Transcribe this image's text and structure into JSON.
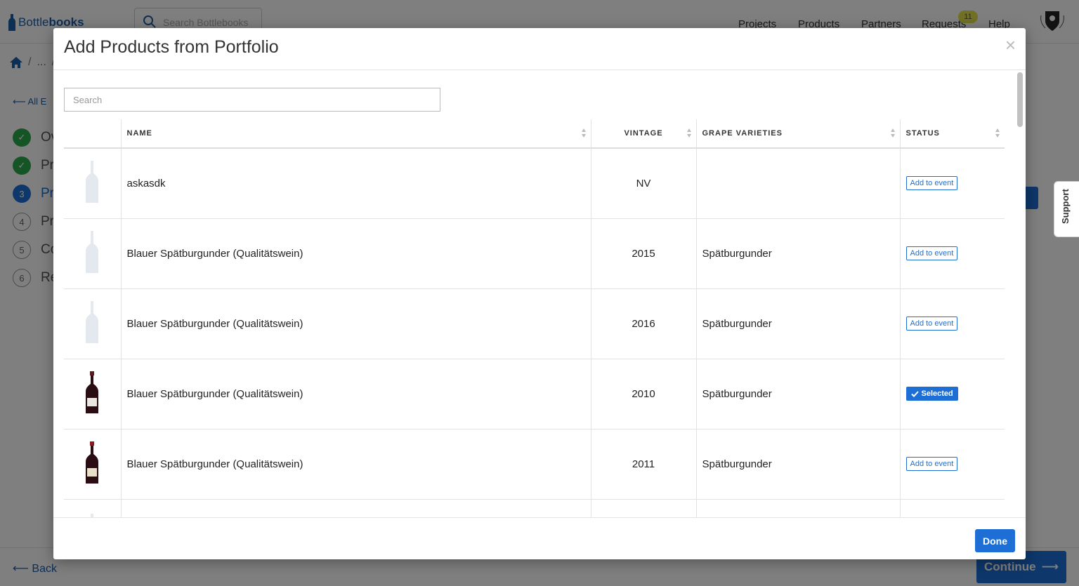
{
  "app": {
    "logo_prefix": "Bottle",
    "logo_suffix": "books",
    "search_placeholder": "Search Bottlebooks",
    "nav": [
      "Projects",
      "Products",
      "Partners",
      "Requests",
      "Help"
    ],
    "requests_badge": "11"
  },
  "breadcrumb": {
    "ellipsis": "..."
  },
  "sidebar": {
    "back_label": "All E",
    "steps": [
      {
        "marker": "✓",
        "label": "Ov",
        "state": "done"
      },
      {
        "marker": "✓",
        "label": "Pr",
        "state": "done"
      },
      {
        "marker": "3",
        "label": "Pr",
        "state": "current"
      },
      {
        "marker": "4",
        "label": "Pr",
        "state": "todo"
      },
      {
        "marker": "5",
        "label": "Co",
        "state": "todo"
      },
      {
        "marker": "6",
        "label": "Re",
        "state": "todo"
      }
    ]
  },
  "support_label": "Support",
  "footer": {
    "back_label": "Back",
    "continue_label": "Continue"
  },
  "modal": {
    "title": "Add Products from Portfolio",
    "close": "×",
    "search_placeholder": "Search",
    "columns": {
      "name": "NAME",
      "vintage": "VINTAGE",
      "grape": "GRAPE VARIETIES",
      "status": "STATUS"
    },
    "rows": [
      {
        "name": "askasdk",
        "vintage": "NV",
        "grape": "",
        "status": "Add to event",
        "selected": false,
        "image": "placeholder"
      },
      {
        "name": "Blauer Spätburgunder (Qualitätswein)",
        "vintage": "2015",
        "grape": "Spätburgunder",
        "status": "Add to event",
        "selected": false,
        "image": "placeholder"
      },
      {
        "name": "Blauer Spätburgunder (Qualitätswein)",
        "vintage": "2016",
        "grape": "Spätburgunder",
        "status": "Add to event",
        "selected": false,
        "image": "placeholder"
      },
      {
        "name": "Blauer Spätburgunder (Qualitätswein)",
        "vintage": "2010",
        "grape": "Spätburgunder",
        "status": "Selected",
        "selected": true,
        "image": "bottle"
      },
      {
        "name": "Blauer Spätburgunder (Qualitätswein)",
        "vintage": "2011",
        "grape": "Spätburgunder",
        "status": "Add to event",
        "selected": false,
        "image": "bottle"
      },
      {
        "name": "",
        "vintage": "",
        "grape": "",
        "status": "",
        "selected": false,
        "image": "placeholder"
      }
    ],
    "done_label": "Done"
  },
  "colors": {
    "primary": "#1d6fd6",
    "success": "#2aa84a",
    "badge": "#e3e14a"
  },
  "icons": {
    "search": "search-icon",
    "home": "home-icon",
    "check": "check-icon",
    "arrow_left": "arrow-left-icon",
    "arrow_right": "arrow-right-icon",
    "close": "close-icon",
    "bottle": "wine-bottle-icon"
  }
}
